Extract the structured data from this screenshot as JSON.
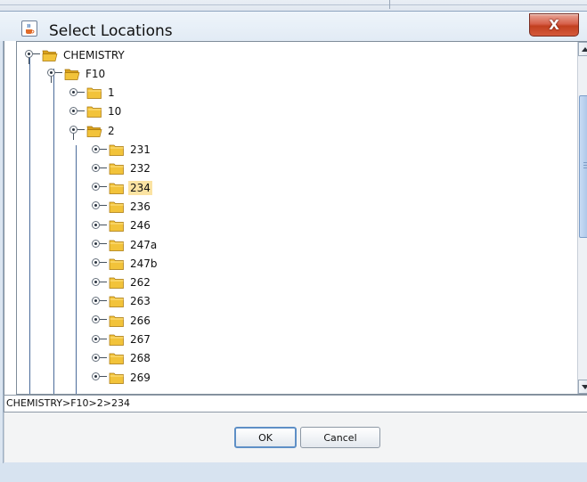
{
  "window": {
    "title": "Select Locations",
    "close_label": "X"
  },
  "tree": {
    "nodes": [
      {
        "label": "CHEMISTRY",
        "level": 0,
        "expanded": true,
        "selected": false
      },
      {
        "label": "F10",
        "level": 1,
        "expanded": true,
        "selected": false
      },
      {
        "label": "1",
        "level": 2,
        "expanded": false,
        "selected": false
      },
      {
        "label": "10",
        "level": 2,
        "expanded": false,
        "selected": false
      },
      {
        "label": "2",
        "level": 2,
        "expanded": true,
        "selected": false
      },
      {
        "label": "231",
        "level": 3,
        "expanded": false,
        "selected": false
      },
      {
        "label": "232",
        "level": 3,
        "expanded": false,
        "selected": false
      },
      {
        "label": "234",
        "level": 3,
        "expanded": false,
        "selected": true
      },
      {
        "label": "236",
        "level": 3,
        "expanded": false,
        "selected": false
      },
      {
        "label": "246",
        "level": 3,
        "expanded": false,
        "selected": false
      },
      {
        "label": "247a",
        "level": 3,
        "expanded": false,
        "selected": false
      },
      {
        "label": "247b",
        "level": 3,
        "expanded": false,
        "selected": false
      },
      {
        "label": "262",
        "level": 3,
        "expanded": false,
        "selected": false
      },
      {
        "label": "263",
        "level": 3,
        "expanded": false,
        "selected": false
      },
      {
        "label": "266",
        "level": 3,
        "expanded": false,
        "selected": false
      },
      {
        "label": "267",
        "level": 3,
        "expanded": false,
        "selected": false
      },
      {
        "label": "268",
        "level": 3,
        "expanded": false,
        "selected": false
      },
      {
        "label": "269",
        "level": 3,
        "expanded": false,
        "selected": false
      }
    ]
  },
  "path": {
    "value": "CHEMISTRY>F10>2>234"
  },
  "buttons": {
    "ok_label": "OK",
    "cancel_label": "Cancel"
  },
  "colors": {
    "selection": "#fbe3a2",
    "close_button": "#c2401f",
    "folder": "#f2c33a",
    "tree_guide": "#4b6b9a"
  },
  "icons": {
    "title": "java-cup-icon",
    "close": "close-icon",
    "folder": "folder-icon",
    "expand_handle": "tree-handle-icon",
    "scroll_up": "arrow-up-icon",
    "scroll_down": "arrow-down-icon"
  }
}
